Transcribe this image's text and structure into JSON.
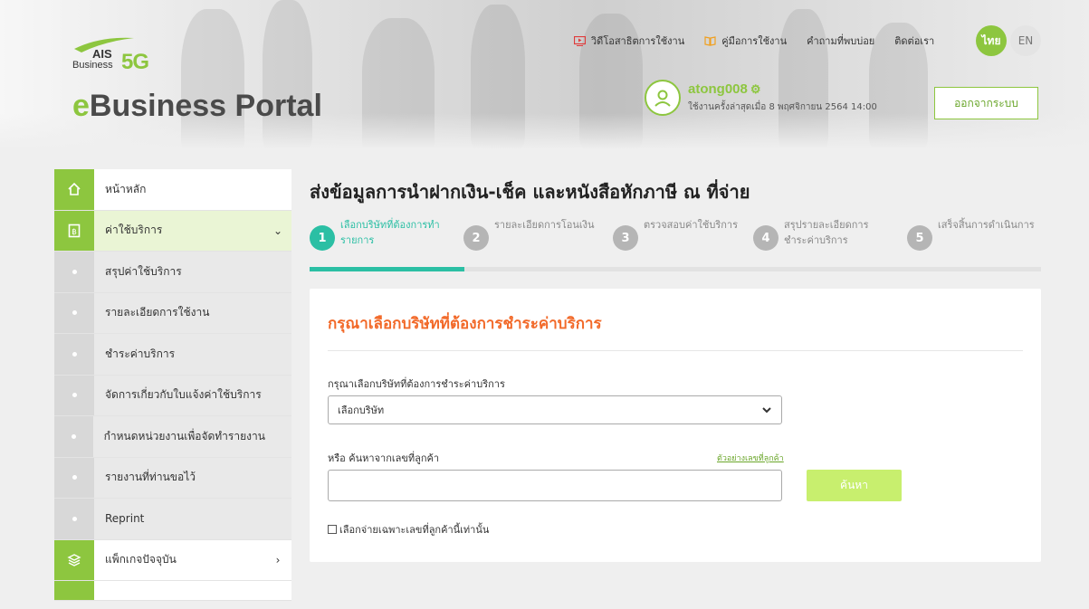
{
  "brand": {
    "logo_ais": "AIS",
    "logo_business": "Business",
    "logo_5g": "5G",
    "portal_e": "e",
    "portal_rest": "Business Portal",
    "accent": "#8dc63f"
  },
  "toplinks": [
    {
      "label": "วิดีโอสาธิตการใช้งาน",
      "icon": "video-icon"
    },
    {
      "label": "คู่มือการใช้งาน",
      "icon": "book-icon"
    },
    {
      "label": "คำถามที่พบบ่อย"
    },
    {
      "label": "ติดต่อเรา"
    }
  ],
  "language": {
    "th": "ไทย",
    "en": "EN",
    "selected": "ไทย"
  },
  "user": {
    "name": "atong008",
    "last_login": "ใช้งานครั้งล่าสุดเมื่อ 8 พฤศจิกายน 2564 14:00",
    "logout_label": "ออกจากระบบ"
  },
  "sidebar": {
    "items": [
      {
        "label": "หน้าหลัก",
        "icon": "home-icon"
      },
      {
        "label": "ค่าใช้บริการ",
        "icon": "bill-icon",
        "arrow": "⌄"
      },
      {
        "label": "สรุปค่าใช้บริการ"
      },
      {
        "label": "รายละเอียดการใช้งาน"
      },
      {
        "label": "ชำระค่าบริการ"
      },
      {
        "label": "จัดการเกี่ยวกับใบแจ้งค่าใช้บริการ"
      },
      {
        "label": "กำหนดหน่วยงานเพื่อจัดทำรายงาน"
      },
      {
        "label": "รายงานที่ท่านขอไว้"
      },
      {
        "label": "Reprint"
      },
      {
        "label": "แพ็กเกจปัจจุบัน",
        "icon": "layers-icon",
        "arrow": "›"
      }
    ]
  },
  "page": {
    "title": "ส่งข้อมูลการนำฝากเงิน-เช็ค และหนังสือหักภาษี ณ ที่จ่าย"
  },
  "steps": [
    {
      "num": "1",
      "label": "เลือกบริษัทที่ต้องการทำรายการ",
      "active": true
    },
    {
      "num": "2",
      "label": "รายละเอียดการโอนเงิน"
    },
    {
      "num": "3",
      "label": "ตรวจสอบค่าใช้บริการ"
    },
    {
      "num": "4",
      "label": "สรุปรายละเอียดการชำระค่าบริการ"
    },
    {
      "num": "5",
      "label": "เสร็จสิ้นการดำเนินการ"
    }
  ],
  "form": {
    "heading": "กรุณาเลือกบริษัทที่ต้องการชำระค่าบริการ",
    "select_label": "กรุณาเลือกบริษัทที่ต้องการชำระค่าบริการ",
    "select_value": "เลือกบริษัท",
    "search_label": "หรือ ค้นหาจากเลขที่ลูกค้า",
    "example_link": "ตัวอย่างเลขที่ลูกค้า",
    "search_value": "",
    "search_button": "ค้นหา",
    "checkbox_label": "เลือกจ่ายเฉพาะเลขที่ลูกค้านี้เท่านั้น"
  }
}
